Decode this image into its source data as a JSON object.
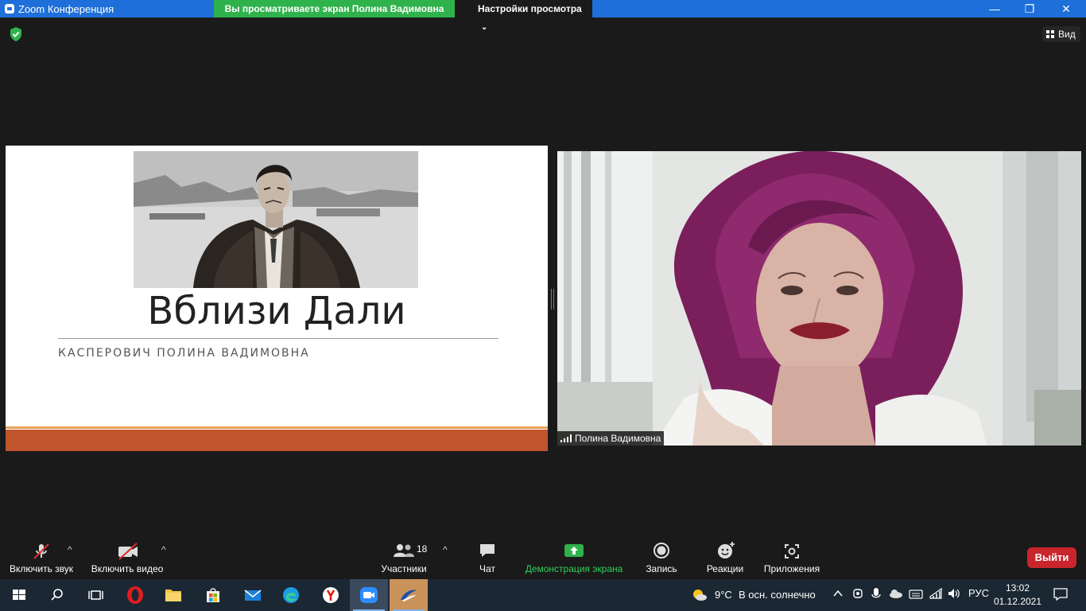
{
  "window": {
    "title": "Zoom Конференция",
    "share_banner": "Вы просматриваете экран Полина Вадимовна",
    "view_settings": "Настройки просмотра",
    "minimize": "—",
    "maximize": "❐",
    "close": "✕"
  },
  "top": {
    "view_label": "Вид"
  },
  "slide": {
    "title": "Вблизи Дали",
    "subtitle": "КАСПЕРОВИЧ ПОЛИНА ВАДИМОВНА"
  },
  "participant": {
    "name": "Полина Вадимовна"
  },
  "toolbar": {
    "audio_label": "Включить звук",
    "video_label": "Включить видео",
    "participants_label": "Участники",
    "participants_count": "18",
    "chat_label": "Чат",
    "share_label": "Демонстрация экрана",
    "record_label": "Запись",
    "reactions_label": "Реакции",
    "apps_label": "Приложения",
    "leave_label": "Выйти",
    "caret": "^"
  },
  "taskbar": {
    "weather_temp": "9°C",
    "weather_text": "В осн. солнечно",
    "language": "РУС",
    "time": "13:02",
    "date": "01.12.2021"
  },
  "colors": {
    "share_green": "#2fb24c",
    "leave_red": "#c9252c",
    "slide_accent": "#c0552e",
    "titlebar_blue": "#1e6fd9"
  }
}
